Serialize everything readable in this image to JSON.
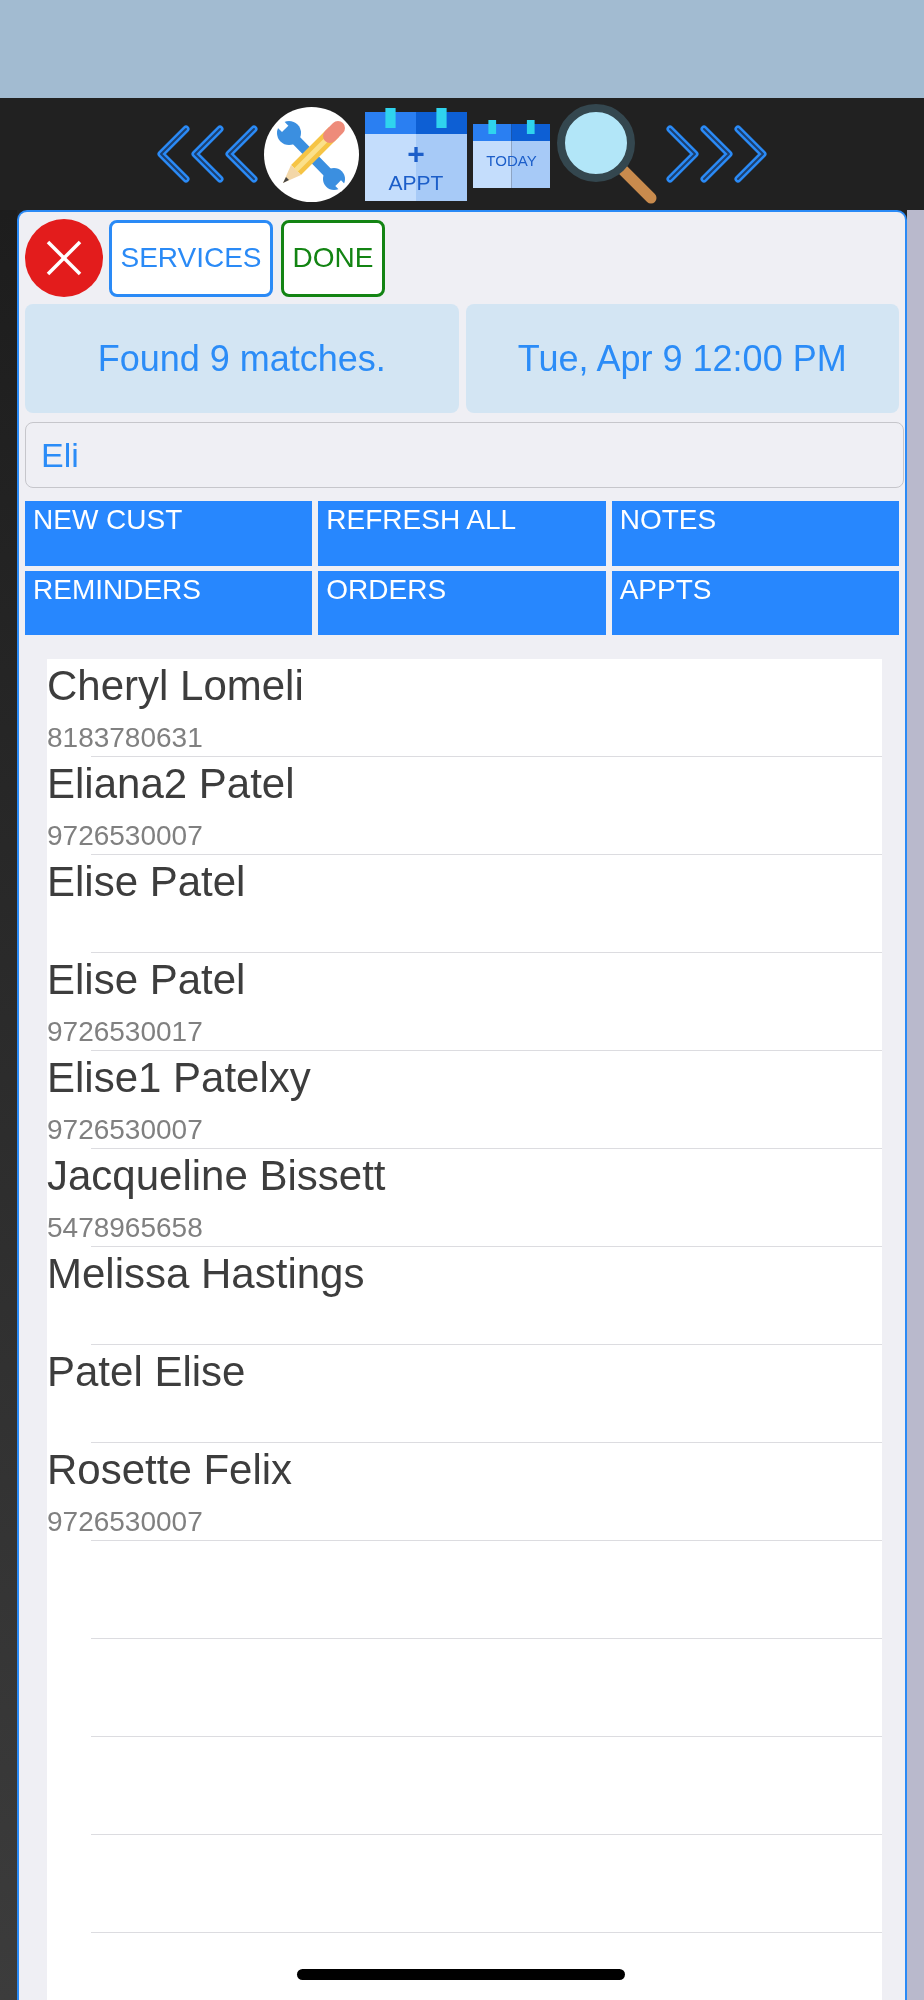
{
  "toolbar": {
    "add_appointment": {
      "symbol": "+",
      "label": "APPT"
    },
    "today": {
      "label": "TODAY"
    }
  },
  "header_buttons": [
    {
      "label": "SERVICES",
      "color": "#2a8af6"
    },
    {
      "label": "DONE",
      "color": "#138413"
    }
  ],
  "status": {
    "message": "Found 9 matches.",
    "date_time": "Tue, Apr 9 12:00 PM"
  },
  "search": {
    "value": "Eli"
  },
  "actions": [
    "NEW CUST",
    "REFRESH ALL",
    "NOTES",
    "REMINDERS",
    "ORDERS",
    "APPTS"
  ],
  "customers": [
    {
      "name": "Cheryl Lomeli",
      "phone": "8183780631"
    },
    {
      "name": "Eliana2 Patel",
      "phone": "9726530007"
    },
    {
      "name": "Elise Patel"
    },
    {
      "name": "Elise Patel",
      "phone": "9726530017"
    },
    {
      "name": "Elise1 Patelxy",
      "phone": "9726530007"
    },
    {
      "name": "Jacqueline Bissett",
      "phone": "5478965658"
    },
    {
      "name": "Melissa Hastings"
    },
    {
      "name": "Patel Elise"
    },
    {
      "name": "Rosette Felix",
      "phone": "9726530007"
    }
  ]
}
